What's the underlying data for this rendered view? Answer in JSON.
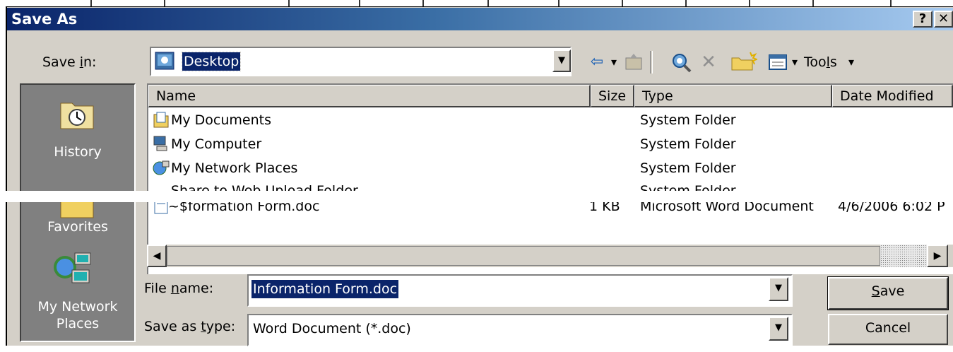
{
  "window": {
    "title": "Save As",
    "help_label": "?",
    "close_label": "✕"
  },
  "save_in": {
    "label": "Save in:",
    "value": "Desktop",
    "icon": "desktop-icon"
  },
  "toolbar": {
    "back_icon": "⇦",
    "back_dropdown": "▾",
    "up_folder_icon": "up-one-level-icon",
    "search_web_icon": "search-web-icon",
    "delete_icon": "✕",
    "new_folder_icon": "new-folder-icon",
    "views_icon": "views-icon",
    "views_dropdown": "▾",
    "tools_label": "Tools",
    "tools_dropdown": "▾"
  },
  "places": [
    {
      "label": "History",
      "icon": "history-icon"
    },
    {
      "label": "Favorites",
      "icon": "favorites-icon"
    },
    {
      "label": "My Network Places",
      "icon": "network-places-icon"
    }
  ],
  "columns": {
    "name": "Name",
    "size": "Size",
    "type": "Type",
    "date": "Date Modified"
  },
  "files": [
    {
      "name": "My Documents",
      "size": "",
      "type": "System Folder",
      "date": ""
    },
    {
      "name": "My Computer",
      "size": "",
      "type": "System Folder",
      "date": ""
    },
    {
      "name": "My Network Places",
      "size": "",
      "type": "System Folder",
      "date": ""
    },
    {
      "name": "Share to Web Upload Folder",
      "size": "",
      "type": "System Folder",
      "date": ""
    },
    {
      "name": "~$formation Form.doc",
      "size": "1 KB",
      "type": "Microsoft Word Document",
      "date": "4/6/2006 6:02 P"
    }
  ],
  "file_name": {
    "label": "File name:",
    "value": "Information Form.doc"
  },
  "save_type": {
    "label": "Save as type:",
    "value": "Word Document (*.doc)"
  },
  "buttons": {
    "save": "Save",
    "cancel": "Cancel"
  },
  "colors": {
    "title_start": "#0a246a",
    "title_end": "#a6caf0",
    "face": "#d4d0c8",
    "selection": "#0a246a"
  }
}
